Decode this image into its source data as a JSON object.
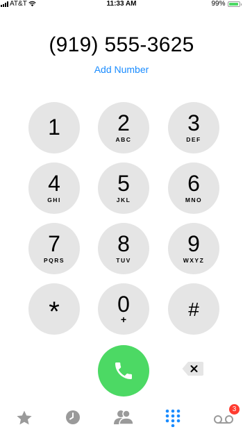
{
  "status_bar": {
    "carrier": "AT&T",
    "time": "11:33 AM",
    "battery_text": "99%",
    "battery_level": 0.99,
    "battery_color": "#4cd964"
  },
  "dialer": {
    "number": "(919) 555-3625",
    "add_number_label": "Add Number",
    "accent_color": "#1a8cff"
  },
  "keypad": {
    "keys": [
      {
        "digit": "1",
        "letters": ""
      },
      {
        "digit": "2",
        "letters": "ABC"
      },
      {
        "digit": "3",
        "letters": "DEF"
      },
      {
        "digit": "4",
        "letters": "GHI"
      },
      {
        "digit": "5",
        "letters": "JKL"
      },
      {
        "digit": "6",
        "letters": "MNO"
      },
      {
        "digit": "7",
        "letters": "PQRS"
      },
      {
        "digit": "8",
        "letters": "TUV"
      },
      {
        "digit": "9",
        "letters": "WXYZ"
      },
      {
        "digit": "*",
        "letters": ""
      },
      {
        "digit": "0",
        "letters": "+"
      },
      {
        "digit": "#",
        "letters": ""
      }
    ],
    "key_color": "#e5e5e5"
  },
  "actions": {
    "call_icon": "phone-icon",
    "call_color": "#4cd964",
    "delete_icon": "delete-backspace-icon"
  },
  "tab_bar": {
    "tabs": [
      {
        "name": "favorites",
        "icon": "star-icon",
        "active": false
      },
      {
        "name": "recents",
        "icon": "clock-icon",
        "active": false
      },
      {
        "name": "contacts",
        "icon": "contacts-icon",
        "active": false
      },
      {
        "name": "keypad",
        "icon": "keypad-grid-icon",
        "active": true
      },
      {
        "name": "voicemail",
        "icon": "voicemail-icon",
        "active": false
      }
    ],
    "voicemail_badge": "3",
    "active_color": "#1a8cff",
    "inactive_color": "#9a9a9a",
    "badge_color": "#ff3b30"
  }
}
